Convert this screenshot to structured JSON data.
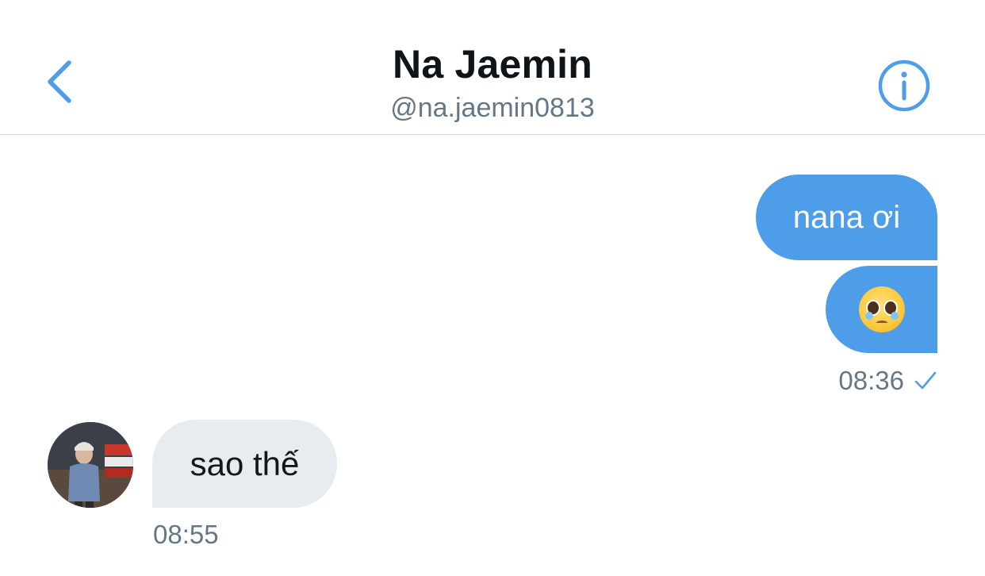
{
  "header": {
    "title": "Na Jaemin",
    "handle": "@na.jaemin0813",
    "back_icon": "chevron-left-icon",
    "info_icon": "info-icon",
    "accent_color": "#4d9de8"
  },
  "messages": {
    "sent": [
      {
        "text": "nana ơi"
      },
      {
        "emoji": "pleading-face"
      }
    ],
    "sent_time": "08:36",
    "sent_status_icon": "checkmark-icon",
    "received": [
      {
        "text": "sao thế"
      }
    ],
    "received_time": "08:55"
  },
  "colors": {
    "sent_bubble": "#4d9de8",
    "received_bubble": "#e6ecf0",
    "secondary_text": "#657786"
  }
}
